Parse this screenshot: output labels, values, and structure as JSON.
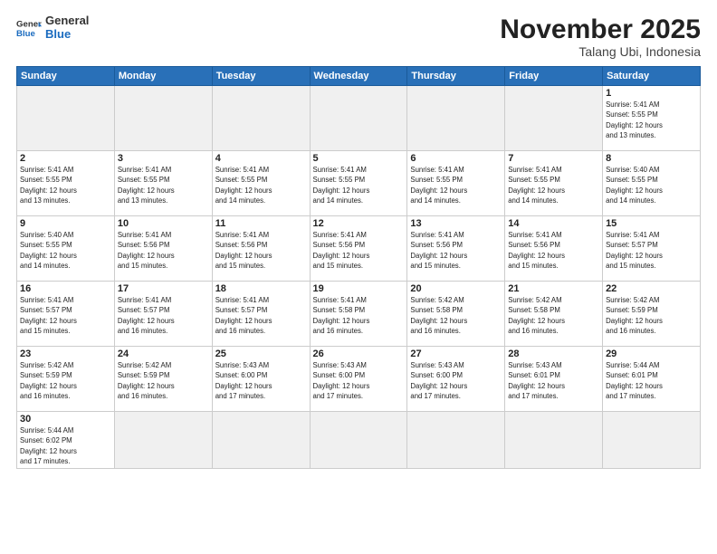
{
  "logo": {
    "general": "General",
    "blue": "Blue"
  },
  "header": {
    "month": "November 2025",
    "location": "Talang Ubi, Indonesia"
  },
  "days": [
    "Sunday",
    "Monday",
    "Tuesday",
    "Wednesday",
    "Thursday",
    "Friday",
    "Saturday"
  ],
  "weeks": [
    [
      {
        "date": "",
        "info": ""
      },
      {
        "date": "",
        "info": ""
      },
      {
        "date": "",
        "info": ""
      },
      {
        "date": "",
        "info": ""
      },
      {
        "date": "",
        "info": ""
      },
      {
        "date": "",
        "info": ""
      },
      {
        "date": "1",
        "info": "Sunrise: 5:41 AM\nSunset: 5:55 PM\nDaylight: 12 hours\nand 13 minutes."
      }
    ],
    [
      {
        "date": "2",
        "info": "Sunrise: 5:41 AM\nSunset: 5:55 PM\nDaylight: 12 hours\nand 13 minutes."
      },
      {
        "date": "3",
        "info": "Sunrise: 5:41 AM\nSunset: 5:55 PM\nDaylight: 12 hours\nand 13 minutes."
      },
      {
        "date": "4",
        "info": "Sunrise: 5:41 AM\nSunset: 5:55 PM\nDaylight: 12 hours\nand 14 minutes."
      },
      {
        "date": "5",
        "info": "Sunrise: 5:41 AM\nSunset: 5:55 PM\nDaylight: 12 hours\nand 14 minutes."
      },
      {
        "date": "6",
        "info": "Sunrise: 5:41 AM\nSunset: 5:55 PM\nDaylight: 12 hours\nand 14 minutes."
      },
      {
        "date": "7",
        "info": "Sunrise: 5:41 AM\nSunset: 5:55 PM\nDaylight: 12 hours\nand 14 minutes."
      },
      {
        "date": "8",
        "info": "Sunrise: 5:40 AM\nSunset: 5:55 PM\nDaylight: 12 hours\nand 14 minutes."
      }
    ],
    [
      {
        "date": "9",
        "info": "Sunrise: 5:40 AM\nSunset: 5:55 PM\nDaylight: 12 hours\nand 14 minutes."
      },
      {
        "date": "10",
        "info": "Sunrise: 5:41 AM\nSunset: 5:56 PM\nDaylight: 12 hours\nand 15 minutes."
      },
      {
        "date": "11",
        "info": "Sunrise: 5:41 AM\nSunset: 5:56 PM\nDaylight: 12 hours\nand 15 minutes."
      },
      {
        "date": "12",
        "info": "Sunrise: 5:41 AM\nSunset: 5:56 PM\nDaylight: 12 hours\nand 15 minutes."
      },
      {
        "date": "13",
        "info": "Sunrise: 5:41 AM\nSunset: 5:56 PM\nDaylight: 12 hours\nand 15 minutes."
      },
      {
        "date": "14",
        "info": "Sunrise: 5:41 AM\nSunset: 5:56 PM\nDaylight: 12 hours\nand 15 minutes."
      },
      {
        "date": "15",
        "info": "Sunrise: 5:41 AM\nSunset: 5:57 PM\nDaylight: 12 hours\nand 15 minutes."
      }
    ],
    [
      {
        "date": "16",
        "info": "Sunrise: 5:41 AM\nSunset: 5:57 PM\nDaylight: 12 hours\nand 15 minutes."
      },
      {
        "date": "17",
        "info": "Sunrise: 5:41 AM\nSunset: 5:57 PM\nDaylight: 12 hours\nand 16 minutes."
      },
      {
        "date": "18",
        "info": "Sunrise: 5:41 AM\nSunset: 5:57 PM\nDaylight: 12 hours\nand 16 minutes."
      },
      {
        "date": "19",
        "info": "Sunrise: 5:41 AM\nSunset: 5:58 PM\nDaylight: 12 hours\nand 16 minutes."
      },
      {
        "date": "20",
        "info": "Sunrise: 5:42 AM\nSunset: 5:58 PM\nDaylight: 12 hours\nand 16 minutes."
      },
      {
        "date": "21",
        "info": "Sunrise: 5:42 AM\nSunset: 5:58 PM\nDaylight: 12 hours\nand 16 minutes."
      },
      {
        "date": "22",
        "info": "Sunrise: 5:42 AM\nSunset: 5:59 PM\nDaylight: 12 hours\nand 16 minutes."
      }
    ],
    [
      {
        "date": "23",
        "info": "Sunrise: 5:42 AM\nSunset: 5:59 PM\nDaylight: 12 hours\nand 16 minutes."
      },
      {
        "date": "24",
        "info": "Sunrise: 5:42 AM\nSunset: 5:59 PM\nDaylight: 12 hours\nand 16 minutes."
      },
      {
        "date": "25",
        "info": "Sunrise: 5:43 AM\nSunset: 6:00 PM\nDaylight: 12 hours\nand 17 minutes."
      },
      {
        "date": "26",
        "info": "Sunrise: 5:43 AM\nSunset: 6:00 PM\nDaylight: 12 hours\nand 17 minutes."
      },
      {
        "date": "27",
        "info": "Sunrise: 5:43 AM\nSunset: 6:00 PM\nDaylight: 12 hours\nand 17 minutes."
      },
      {
        "date": "28",
        "info": "Sunrise: 5:43 AM\nSunset: 6:01 PM\nDaylight: 12 hours\nand 17 minutes."
      },
      {
        "date": "29",
        "info": "Sunrise: 5:44 AM\nSunset: 6:01 PM\nDaylight: 12 hours\nand 17 minutes."
      }
    ],
    [
      {
        "date": "30",
        "info": "Sunrise: 5:44 AM\nSunset: 6:02 PM\nDaylight: 12 hours\nand 17 minutes."
      },
      {
        "date": "",
        "info": ""
      },
      {
        "date": "",
        "info": ""
      },
      {
        "date": "",
        "info": ""
      },
      {
        "date": "",
        "info": ""
      },
      {
        "date": "",
        "info": ""
      },
      {
        "date": "",
        "info": ""
      }
    ]
  ]
}
